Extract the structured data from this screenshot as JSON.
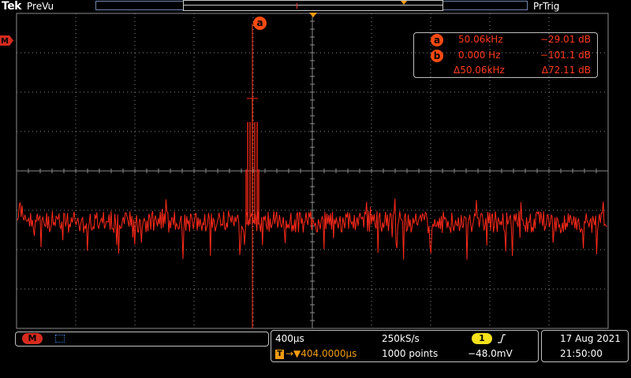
{
  "header": {
    "brand": "Tek",
    "mode": "PreVu",
    "trigger_state": "PrTrig"
  },
  "channel_marker": "M",
  "cursor_readout": {
    "a_label": "a",
    "a_freq": "50.06kHz",
    "a_level": "−29.01 dB",
    "b_label": "b",
    "b_freq": "0.000 Hz",
    "b_level": "−101.1 dB",
    "delta_freq": "Δ50.06kHz",
    "delta_level": "Δ72.11 dB"
  },
  "cursor_a_marker": "a",
  "status": {
    "math_label": "M",
    "timebase": "400µs",
    "sample_rate": "250kS/s",
    "trigger_channel": "1",
    "trigger_slope_icon": "rising-edge",
    "trigger_position": "→▼404.0000µs",
    "trigger_icon_label": "T",
    "record_length": "1000 points",
    "trigger_level": "−48.0mV",
    "date": "17 Aug 2021",
    "time": "21:50:00"
  },
  "colors": {
    "trace": "#ff2a1a",
    "cursor": "#ff4a12",
    "trigger_marker": "#f39c12",
    "channel1": "#f4e11b",
    "graticule": "#8a8a8a"
  }
}
